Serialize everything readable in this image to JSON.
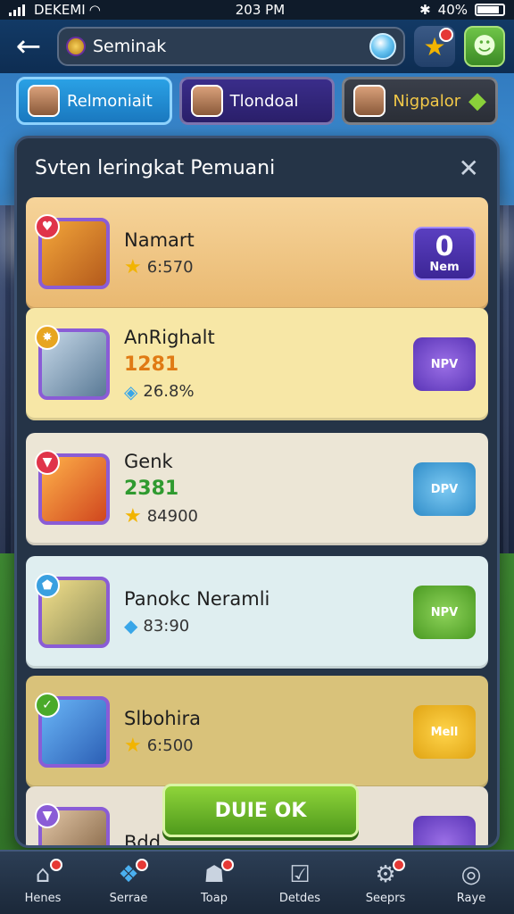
{
  "status_bar": {
    "carrier": "DEKEMI",
    "time": "203 PM",
    "battery": "40%"
  },
  "top_nav": {
    "back_icon": "arrow-left-icon",
    "search_text": "Seminak",
    "star_icon": "star-icon",
    "chat_icon": "chat-icon"
  },
  "tabs": [
    {
      "label": "Relmoniait"
    },
    {
      "label": "Tlondoal"
    },
    {
      "label": "Nigpalor"
    }
  ],
  "panel": {
    "title": "Svten leringkat Pemuani",
    "close_icon": "close-icon"
  },
  "players": [
    {
      "name": "Namart",
      "score": "",
      "stat": "6:570",
      "stat_icon": "star",
      "action": "Nem",
      "action_big": "0"
    },
    {
      "name": "AnRighalt",
      "score": "1281",
      "stat": "26.8%",
      "stat_icon": "gem",
      "action": "NPV",
      "action_big": ""
    },
    {
      "name": "Genk",
      "score": "2381",
      "stat": "84900",
      "stat_icon": "star",
      "action": "DPV",
      "action_big": ""
    },
    {
      "name": "Panokc Neramli",
      "score": "",
      "stat": "83:90",
      "stat_icon": "gem",
      "action": "NPV",
      "action_big": ""
    },
    {
      "name": "Slbohira",
      "score": "",
      "stat": "6:500",
      "stat_icon": "star",
      "action": "Mell",
      "action_big": ""
    },
    {
      "name": "Bdd",
      "score": "",
      "stat": "",
      "stat_icon": "",
      "action": "",
      "action_big": ""
    }
  ],
  "ok_button": "DUIE OK",
  "bottom_nav": [
    {
      "label": "Henes",
      "icon": "home-icon"
    },
    {
      "label": "Serrae",
      "icon": "cards-icon"
    },
    {
      "label": "Toap",
      "icon": "helmet-icon"
    },
    {
      "label": "Detdes",
      "icon": "checklist-icon"
    },
    {
      "label": "Seeprs",
      "icon": "gear-icon"
    },
    {
      "label": "Raye",
      "icon": "profile-icon"
    }
  ],
  "colors": {
    "accent": "#2aa1e5",
    "ok_green": "#6fbf2a"
  }
}
